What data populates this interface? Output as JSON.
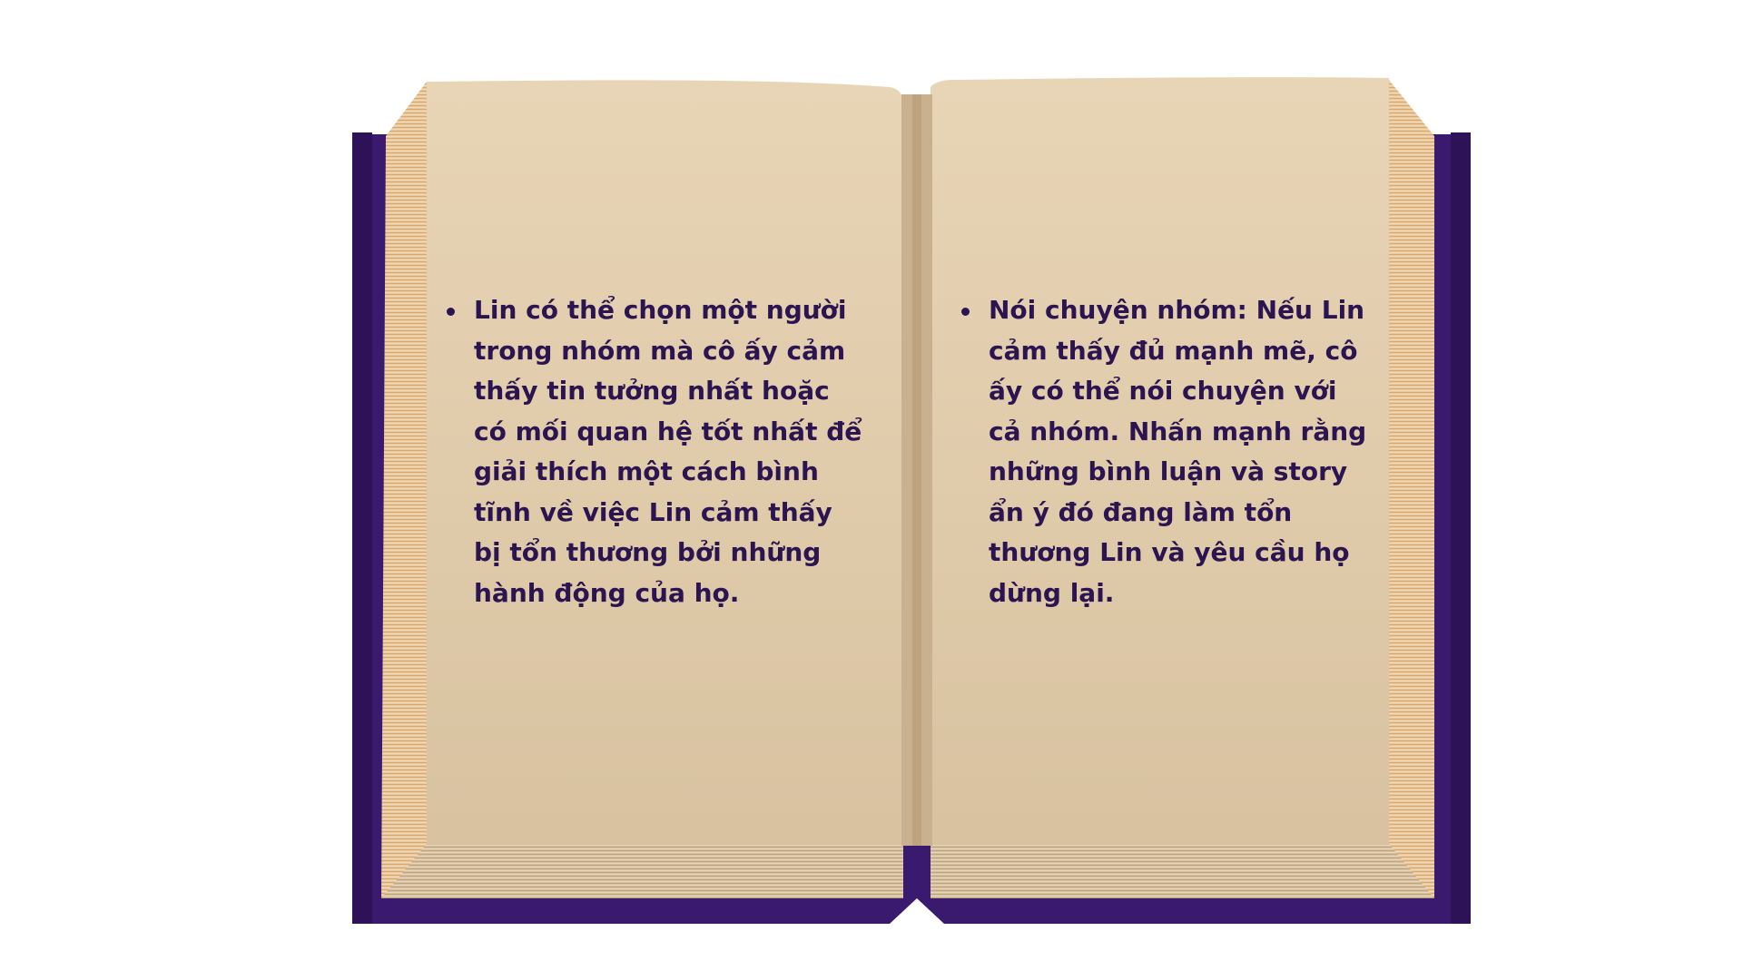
{
  "left_page": {
    "bullets": [
      "Lin có thể chọn một người trong nhóm mà cô ấy cảm thấy tin tưởng nhất hoặc có mối quan hệ tốt nhất để giải thích một cách bình tĩnh về việc Lin cảm thấy bị tổn thương bởi những hành động của họ."
    ]
  },
  "right_page": {
    "bullets": [
      "Nói chuyện nhóm: Nếu Lin cảm thấy đủ mạnh mẽ, cô ấy có thể nói chuyện với cả nhóm. Nhấn mạnh rằng những bình luận và story ẩn ý đó đang làm tổn thương Lin và yêu cầu họ dừng lại."
    ]
  },
  "colors": {
    "cover": "#3a1a6e",
    "page": "#e6d3b5",
    "text": "#2b1450"
  }
}
